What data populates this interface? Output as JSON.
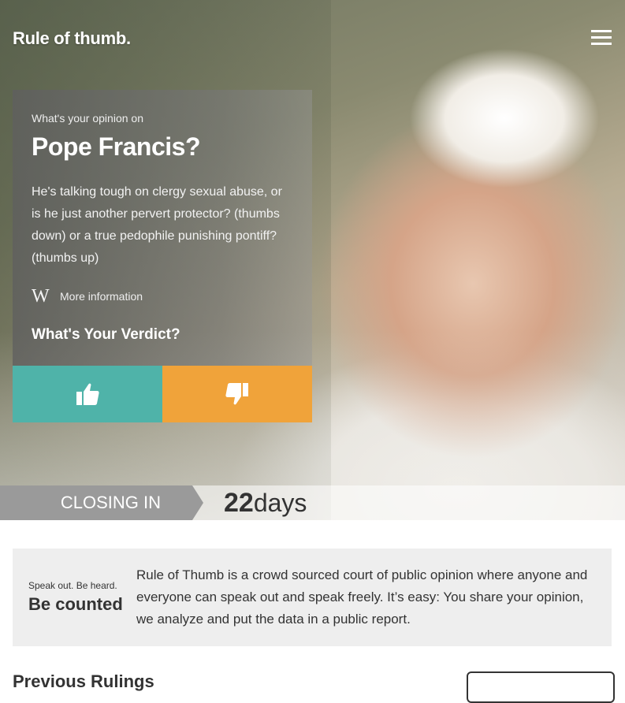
{
  "header": {
    "brand": "Rule of thumb.",
    "menu_icon": "hamburger-menu-icon"
  },
  "poll": {
    "intro": "What's your opinion on",
    "topic": "Pope Francis?",
    "description": "He's talking tough on clergy sexual abuse, or is he just another pervert protector? (thumbs down) or a true pedophile punishing pontiff? (thumbs up)",
    "more_info_icon": "wikipedia-icon",
    "more_info_glyph": "W",
    "more_info_label": "More information",
    "verdict_prompt": "What's Your Verdict?",
    "vote_up_icon": "thumbs-up-icon",
    "vote_down_icon": "thumbs-down-icon",
    "colors": {
      "up": "#4fb3a9",
      "down": "#f0a33a"
    }
  },
  "closing": {
    "label": "CLOSING IN",
    "count": "22",
    "unit": "days"
  },
  "about": {
    "tagline_small": "Speak out. Be heard.",
    "tagline_big": "Be counted",
    "text": "Rule of Thumb is a crowd sourced court of public opinion where anyone and everyone can speak out and speak freely. It’s easy: You share your opinion, we analyze and put the data in a public report."
  },
  "previous": {
    "title": "Previous Rulings"
  }
}
